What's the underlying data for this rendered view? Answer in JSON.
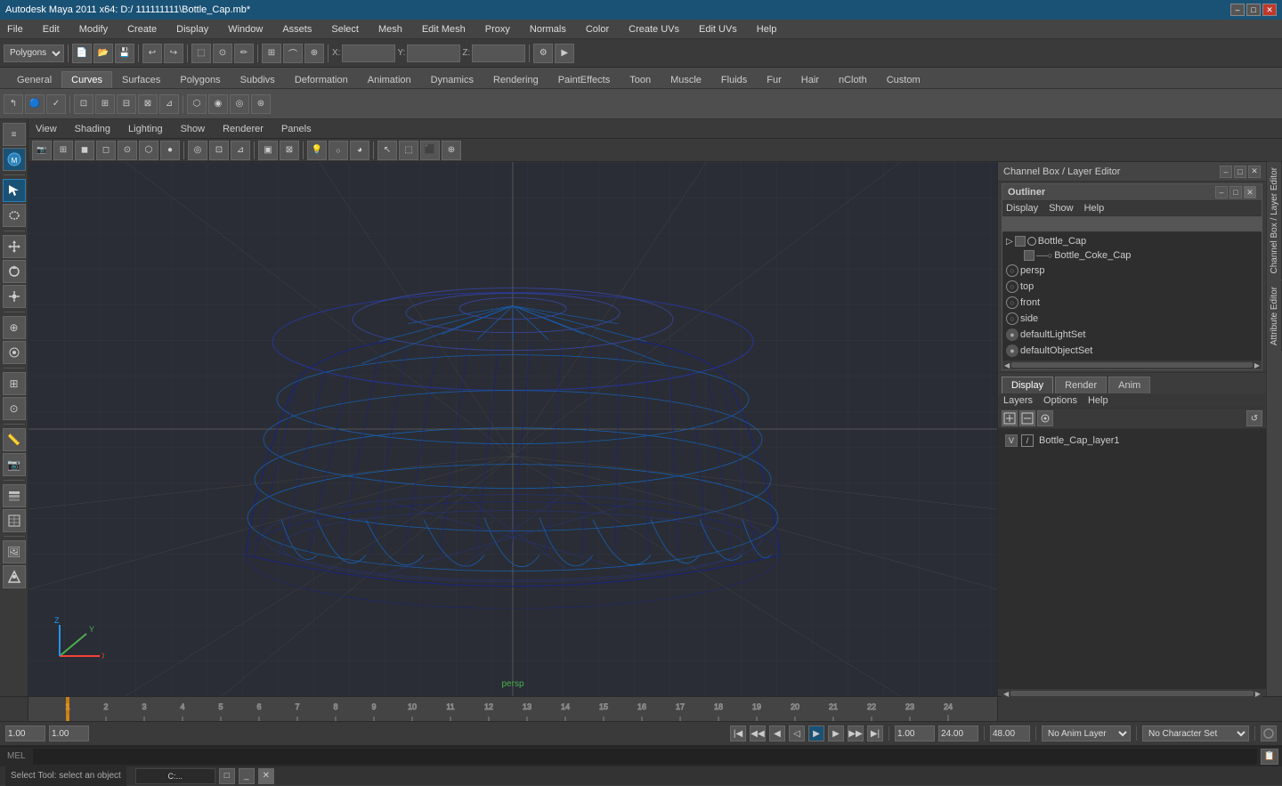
{
  "titleBar": {
    "title": "Autodesk Maya 2011 x64: D:/  111111111\\Bottle_Cap.mb*",
    "minBtn": "–",
    "maxBtn": "□",
    "closeBtn": "✕"
  },
  "menuBar": {
    "items": [
      "File",
      "Edit",
      "Modify",
      "Create",
      "Display",
      "Window",
      "Assets",
      "Select",
      "Mesh",
      "Edit Mesh",
      "Proxy",
      "Normals",
      "Color",
      "Create UVs",
      "Edit UVs",
      "Help"
    ]
  },
  "toolbar": {
    "modeSelect": "Polygons",
    "coordLabel_x": "X:",
    "coordLabel_y": "Y:",
    "coordLabel_z": "Z:"
  },
  "shelfTabs": {
    "tabs": [
      "General",
      "Curves",
      "Surfaces",
      "Polygons",
      "Subdiv s",
      "Deformation",
      "Animation",
      "Dynamics",
      "Rendering",
      "PaintEffects",
      "Toon",
      "Muscle",
      "Fluids",
      "Fur",
      "Hair",
      "nCloth",
      "Custom"
    ]
  },
  "viewportMenu": {
    "items": [
      "View",
      "Shading",
      "Lighting",
      "Show",
      "Renderer",
      "Panels"
    ]
  },
  "outliner": {
    "title": "Outliner",
    "menuItems": [
      "Display",
      "Show",
      "Help"
    ],
    "items": [
      {
        "label": "Bottle_Cap",
        "indent": 0,
        "icon": "📦"
      },
      {
        "label": "Bottle_Coke_Cap",
        "indent": 1,
        "icon": "○"
      },
      {
        "label": "persp",
        "indent": 0,
        "icon": "🎥"
      },
      {
        "label": "top",
        "indent": 0,
        "icon": "🎥"
      },
      {
        "label": "front",
        "indent": 0,
        "icon": "🎥"
      },
      {
        "label": "side",
        "indent": 0,
        "icon": "🎥"
      },
      {
        "label": "defaultLightSet",
        "indent": 0,
        "icon": "💡"
      },
      {
        "label": "defaultObjectSet",
        "indent": 0,
        "icon": "💡"
      }
    ]
  },
  "channelBox": {
    "title": "Channel Box / Layer Editor"
  },
  "layerTabs": {
    "tabs": [
      "Display",
      "Render",
      "Anim"
    ],
    "activeTab": "Display"
  },
  "layerMenu": {
    "items": [
      "Layers",
      "Options",
      "Help"
    ]
  },
  "layers": {
    "items": [
      {
        "vis": "V",
        "name": "Bottle_Cap_layer1"
      }
    ]
  },
  "bottomControls": {
    "timeStart": "1",
    "timeEnd": "24",
    "currentTime": "1.00",
    "playbackStart": "1.00",
    "playbackEnd": "24.00",
    "animRange": "48.00",
    "noAnimLayer": "No Anim Layer",
    "noCharSet": "No Character Set",
    "animLayerOptions": [
      "No Anim Layer"
    ],
    "charSetOptions": [
      "No Character Set"
    ]
  },
  "timelineNums": [
    "1",
    "2",
    "3",
    "4",
    "5",
    "6",
    "7",
    "8",
    "9",
    "10",
    "11",
    "12",
    "13",
    "14",
    "15",
    "16",
    "17",
    "18",
    "19",
    "20",
    "21",
    "22",
    "23",
    "24"
  ],
  "statusBar": {
    "text": "Select Tool: select an object"
  },
  "commandLine": {
    "label": "MEL",
    "placeholder": ""
  },
  "perspLabel": "persp",
  "viewport": {
    "bgColor": "#2a2d35"
  }
}
